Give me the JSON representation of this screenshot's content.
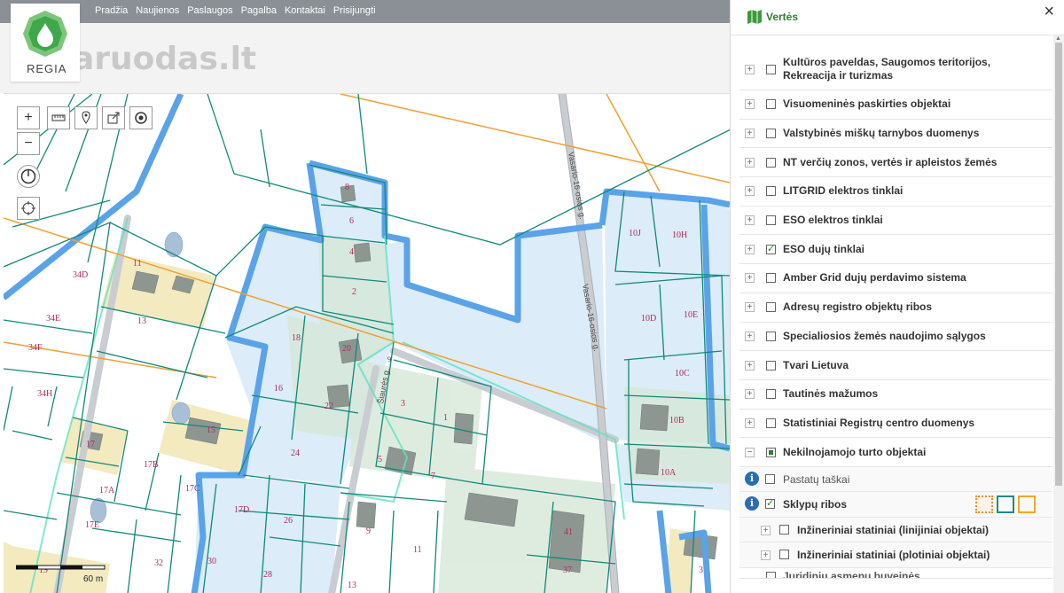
{
  "nav": {
    "items": [
      "Pradžia",
      "Naujienos",
      "Paslaugos",
      "Pagalba",
      "Kontaktai",
      "Prisijungti"
    ]
  },
  "logo": {
    "brand": "REGIA",
    "watermark": "aruodas.lt"
  },
  "map": {
    "parcel_labels": [
      {
        "t": "8"
      },
      {
        "t": "6"
      },
      {
        "t": "4"
      },
      {
        "t": "2"
      },
      {
        "t": "18"
      },
      {
        "t": "20"
      },
      {
        "t": "16"
      },
      {
        "t": "22"
      },
      {
        "t": "24"
      },
      {
        "t": "3"
      },
      {
        "t": "1"
      },
      {
        "t": "5"
      },
      {
        "t": "7"
      },
      {
        "t": "17D"
      },
      {
        "t": "26"
      },
      {
        "t": "9"
      },
      {
        "t": "11"
      },
      {
        "t": "28"
      },
      {
        "t": "13"
      },
      {
        "t": "41"
      },
      {
        "t": "37"
      },
      {
        "t": "10J"
      },
      {
        "t": "10H"
      },
      {
        "t": "10D"
      },
      {
        "t": "10E"
      },
      {
        "t": "10C"
      },
      {
        "t": "10B"
      },
      {
        "t": "10A"
      },
      {
        "t": "3"
      },
      {
        "t": "34D"
      },
      {
        "t": "11"
      },
      {
        "t": "13"
      },
      {
        "t": "34E"
      },
      {
        "t": "34F"
      },
      {
        "t": "34H"
      },
      {
        "t": "17"
      },
      {
        "t": "15"
      },
      {
        "t": "17B"
      },
      {
        "t": "17A"
      },
      {
        "t": "17C"
      },
      {
        "t": "17E"
      },
      {
        "t": "19"
      },
      {
        "t": "32"
      },
      {
        "t": "30"
      },
      {
        "t": "9"
      }
    ],
    "street_labels": [
      "Vasario-16-osios g.",
      "Vasario-16-osios g.",
      "Šiaurės g."
    ],
    "scale_label": "60 m"
  },
  "panel": {
    "title": "Vertės",
    "layers": [
      {
        "label": "Kultūros paveldas, Saugomos teritorijos, Rekreacija ir turizmas",
        "checked": false
      },
      {
        "label": "Visuomeninės paskirties objektai",
        "checked": false
      },
      {
        "label": "Valstybinės miškų tarnybos duomenys",
        "checked": false
      },
      {
        "label": "NT verčių zonos, vertės ir apleistos žemės",
        "checked": false
      },
      {
        "label": "LITGRID elektros tinklai",
        "checked": false
      },
      {
        "label": "ESO elektros tinklai",
        "checked": false
      },
      {
        "label": "ESO dujų tinklai",
        "checked": true
      },
      {
        "label": "Amber Grid dujų perdavimo sistema",
        "checked": false
      },
      {
        "label": "Adresų registro objektų ribos",
        "checked": false
      },
      {
        "label": "Specialiosios žemės naudojimo sąlygos",
        "checked": false
      },
      {
        "label": "Tvari Lietuva",
        "checked": false
      },
      {
        "label": "Tautinės mažumos",
        "checked": false
      },
      {
        "label": "Statistiniai Registrų centro duomenys",
        "checked": false
      },
      {
        "label": "Nekilnojamojo turto objektai",
        "checked": "partial"
      }
    ],
    "sublayers": [
      {
        "label": "Pastatų taškai",
        "checked": false
      },
      {
        "label": "Sklypų ribos",
        "checked": true
      }
    ],
    "nested": [
      {
        "label": "Inžineriniai statiniai (linijiniai objektai)"
      },
      {
        "label": "Inžineriniai statiniai (plotiniai objektai)"
      }
    ],
    "cut_off_label": "Juridinių asmenų buveinės",
    "style_colors": [
      "#f08c28",
      "#1f8a8a",
      "#f5a623"
    ]
  },
  "colors": {
    "parcel_line": "#0f8a7a",
    "highlight": "#5aa3e8",
    "gas_line": "#f0a030",
    "fill_blue": "#dcecf8",
    "fill_yellow": "#f3eac0"
  }
}
